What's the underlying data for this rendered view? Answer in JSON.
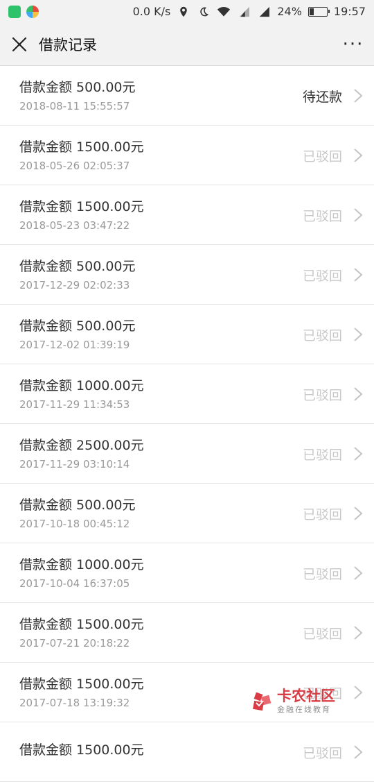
{
  "status_bar": {
    "speed": "0.0 K/s",
    "battery": "24%",
    "battery_level": 0.24,
    "time": "19:57",
    "icons": [
      "chat-app-icon",
      "browser-app-icon",
      "location-icon",
      "moon-icon",
      "wifi-icon",
      "signal-icon",
      "signal-icon",
      "battery-icon"
    ]
  },
  "header": {
    "title": "借款记录",
    "more_label": "···"
  },
  "records": [
    {
      "title": "借款金额 500.00元",
      "date": "2018-08-11 15:55:57",
      "status": "待还款",
      "kind": "pending"
    },
    {
      "title": "借款金额 1500.00元",
      "date": "2018-05-26 02:05:37",
      "status": "已驳回",
      "kind": "rejected"
    },
    {
      "title": "借款金额 1500.00元",
      "date": "2018-05-23 03:47:22",
      "status": "已驳回",
      "kind": "rejected"
    },
    {
      "title": "借款金额 500.00元",
      "date": "2017-12-29 02:02:33",
      "status": "已驳回",
      "kind": "rejected"
    },
    {
      "title": "借款金额 500.00元",
      "date": "2017-12-02 01:39:19",
      "status": "已驳回",
      "kind": "rejected"
    },
    {
      "title": "借款金额 1000.00元",
      "date": "2017-11-29 11:34:53",
      "status": "已驳回",
      "kind": "rejected"
    },
    {
      "title": "借款金额 2500.00元",
      "date": "2017-11-29 03:10:14",
      "status": "已驳回",
      "kind": "rejected"
    },
    {
      "title": "借款金额 500.00元",
      "date": "2017-10-18 00:45:12",
      "status": "已驳回",
      "kind": "rejected"
    },
    {
      "title": "借款金额 1000.00元",
      "date": "2017-10-04 16:37:05",
      "status": "已驳回",
      "kind": "rejected"
    },
    {
      "title": "借款金额 1500.00元",
      "date": "2017-07-21 20:18:22",
      "status": "已驳回",
      "kind": "rejected"
    },
    {
      "title": "借款金额 1500.00元",
      "date": "2017-07-18 13:19:32",
      "status": "已驳回",
      "kind": "rejected"
    },
    {
      "title": "借款金额 1500.00元",
      "date": "",
      "status": "已驳回",
      "kind": "rejected"
    }
  ],
  "watermark": {
    "name": "卡农社区",
    "tagline": "金融在线教育",
    "color": "#d8323a"
  }
}
